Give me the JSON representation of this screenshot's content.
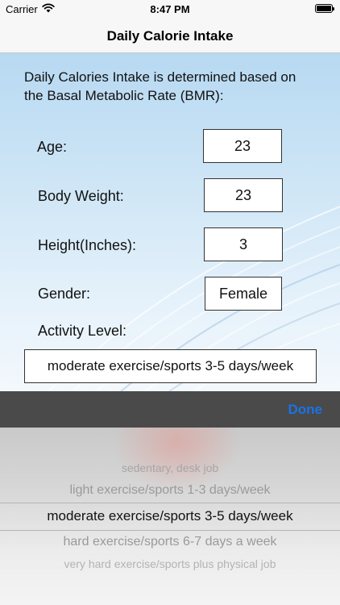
{
  "status_bar": {
    "carrier": "Carrier",
    "time": "8:47 PM"
  },
  "nav": {
    "title": "Daily Calorie Intake"
  },
  "intro": "Daily Calories Intake is determined based on the Basal Metabolic Rate (BMR):",
  "form": {
    "age": {
      "label": "Age:",
      "value": "23"
    },
    "weight": {
      "label": "Body Weight:",
      "value": "23"
    },
    "height": {
      "label": "Height(Inches):",
      "value": "3"
    },
    "gender": {
      "label": "Gender:",
      "value": "Female"
    },
    "activity": {
      "label": "Activity Level:",
      "value": "moderate exercise/sports 3-5 days/week"
    }
  },
  "toolbar": {
    "done_label": "Done"
  },
  "picker": {
    "options": [
      "sedentary, desk job",
      "light exercise/sports 1-3 days/week",
      "moderate exercise/sports 3-5 days/week",
      "hard exercise/sports 6-7 days a week",
      "very hard exercise/sports plus physical job"
    ],
    "selected_index": 2
  },
  "colors": {
    "accent": "#1a73e8",
    "toolbar": "#4a4a4a"
  },
  "icons": [
    "wifi-icon",
    "battery-icon"
  ]
}
